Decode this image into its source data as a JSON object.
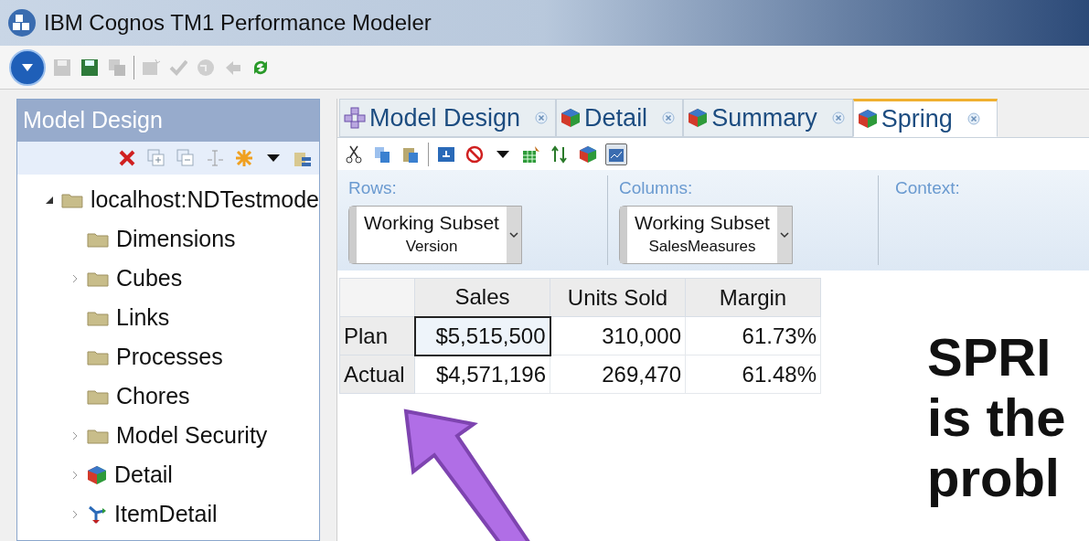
{
  "window": {
    "title": "IBM Cognos TM1 Performance Modeler"
  },
  "sidebar": {
    "title": "Model Design",
    "tree": [
      {
        "label": "localhost:NDTestmode",
        "kind": "folder",
        "expanded": true,
        "children": [
          {
            "label": "Dimensions",
            "kind": "folder"
          },
          {
            "label": "Cubes",
            "kind": "folder",
            "expanded": false
          },
          {
            "label": "Links",
            "kind": "folder"
          },
          {
            "label": "Processes",
            "kind": "folder"
          },
          {
            "label": "Chores",
            "kind": "folder"
          },
          {
            "label": "Model Security",
            "kind": "folder",
            "expanded": false
          },
          {
            "label": "Detail",
            "kind": "cube",
            "expanded": false
          },
          {
            "label": "ItemDetail",
            "kind": "link",
            "expanded": false
          }
        ]
      }
    ]
  },
  "tabs": [
    {
      "label": "Model Design",
      "kind": "model",
      "selected": false
    },
    {
      "label": "Detail",
      "kind": "cube",
      "selected": false
    },
    {
      "label": "Summary",
      "kind": "cube",
      "selected": false
    },
    {
      "label": "Spring",
      "kind": "cube",
      "selected": true
    }
  ],
  "axes": {
    "rows": {
      "label": "Rows:",
      "subset": "Working Subset",
      "dimension": "Version"
    },
    "columns": {
      "label": "Columns:",
      "subset": "Working Subset",
      "dimension": "SalesMeasures"
    },
    "context": {
      "label": "Context:"
    }
  },
  "table": {
    "columns": [
      "Sales",
      "Units Sold",
      "Margin"
    ],
    "rows": [
      {
        "label": "Plan",
        "cells": [
          {
            "text": "$5,515,500",
            "selected": true
          },
          {
            "text": "310,000",
            "selected": false
          },
          {
            "text": "61.73%",
            "selected": false
          }
        ]
      },
      {
        "label": "Actual",
        "cells": [
          {
            "text": "$4,571,196",
            "selected": false
          },
          {
            "text": "269,470",
            "selected": false
          },
          {
            "text": "61.48%",
            "selected": false
          }
        ]
      }
    ]
  },
  "callout": [
    "SPRI",
    "is the",
    "probl"
  ]
}
